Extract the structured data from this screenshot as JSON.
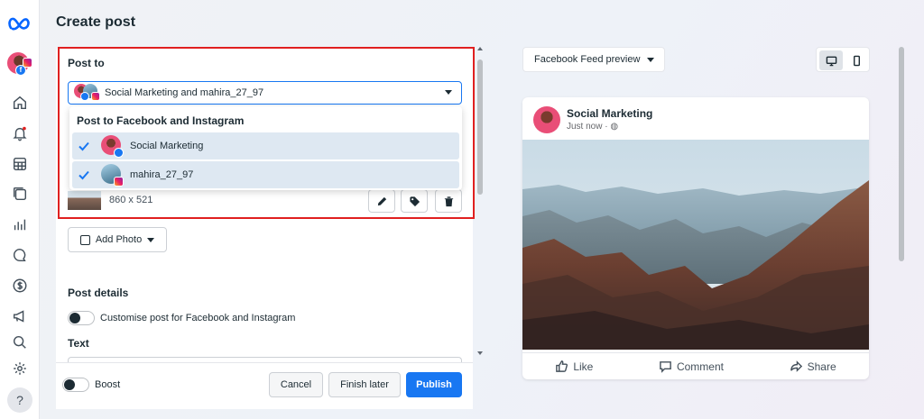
{
  "page": {
    "title": "Create post"
  },
  "post_to": {
    "label": "Post to",
    "selected": "Social Marketing and mahira_27_97",
    "dropdown_title": "Post to Facebook and Instagram",
    "options": [
      {
        "name": "Social Marketing",
        "checked": true,
        "platform": "facebook"
      },
      {
        "name": "mahira_27_97",
        "checked": true,
        "platform": "instagram"
      }
    ]
  },
  "media": {
    "dimensions": "860 x 521"
  },
  "add_photo": {
    "label": "Add Photo"
  },
  "post_details": {
    "label": "Post details",
    "customise_label": "Customise post for Facebook and Instagram",
    "text_label": "Text"
  },
  "footer": {
    "boost_label": "Boost",
    "cancel": "Cancel",
    "finish_later": "Finish later",
    "publish": "Publish"
  },
  "preview": {
    "dropdown": "Facebook Feed preview",
    "page_name": "Social Marketing",
    "time": "Just now ·",
    "actions": {
      "like": "Like",
      "comment": "Comment",
      "share": "Share"
    }
  },
  "colors": {
    "accent": "#1877f2",
    "highlight_border": "#e02020"
  }
}
